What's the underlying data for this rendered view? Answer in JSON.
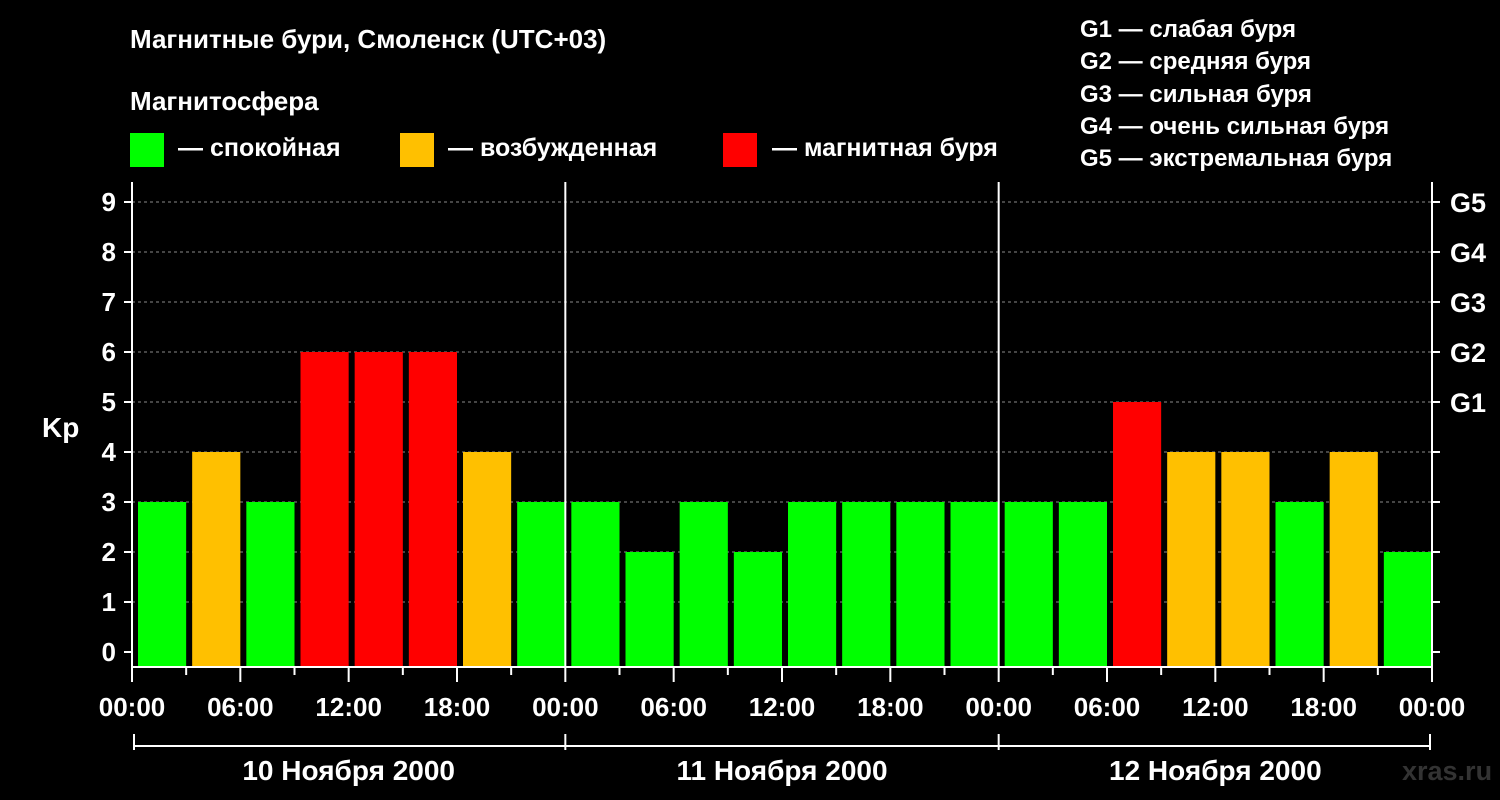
{
  "title": "Магнитные бури, Смоленск (UTC+03)",
  "magnetosphere_label": "Магнитосфера",
  "legend": [
    {
      "label": "— спокойная",
      "color": "#00ff00"
    },
    {
      "label": "— возбужденная",
      "color": "#ffc000"
    },
    {
      "label": "— магнитная буря",
      "color": "#ff0000"
    }
  ],
  "gscale": [
    "G1 — слабая буря",
    "G2 — средняя буря",
    "G3 — сильная буря",
    "G4 — очень сильная буря",
    "G5 — экстремальная буря"
  ],
  "watermark": "xras.ru",
  "chart_data": {
    "type": "bar",
    "ylabel": "Kp",
    "ylim": [
      0,
      9
    ],
    "yticks": [
      0,
      1,
      2,
      3,
      4,
      5,
      6,
      7,
      8,
      9
    ],
    "right_ticks": [
      {
        "value": 5,
        "label": "G1"
      },
      {
        "value": 6,
        "label": "G2"
      },
      {
        "value": 7,
        "label": "G3"
      },
      {
        "value": 8,
        "label": "G4"
      },
      {
        "value": 9,
        "label": "G5"
      }
    ],
    "grid": "dashed horizontal",
    "x_tick_labels": [
      "00:00",
      "06:00",
      "12:00",
      "18:00",
      "00:00",
      "06:00",
      "12:00",
      "18:00",
      "00:00",
      "06:00",
      "12:00",
      "18:00",
      "00:00"
    ],
    "days": [
      "10 Ноября 2000",
      "11 Ноября 2000",
      "12 Ноября 2000"
    ],
    "interval_hours": 3,
    "values": [
      3,
      4,
      3,
      6,
      6,
      6,
      4,
      3,
      3,
      2,
      3,
      2,
      3,
      3,
      3,
      3,
      3,
      3,
      5,
      4,
      4,
      3,
      4,
      2
    ],
    "level_colors": {
      "quiet": "#00ff00",
      "active": "#ffc000",
      "storm": "#ff0000"
    }
  }
}
